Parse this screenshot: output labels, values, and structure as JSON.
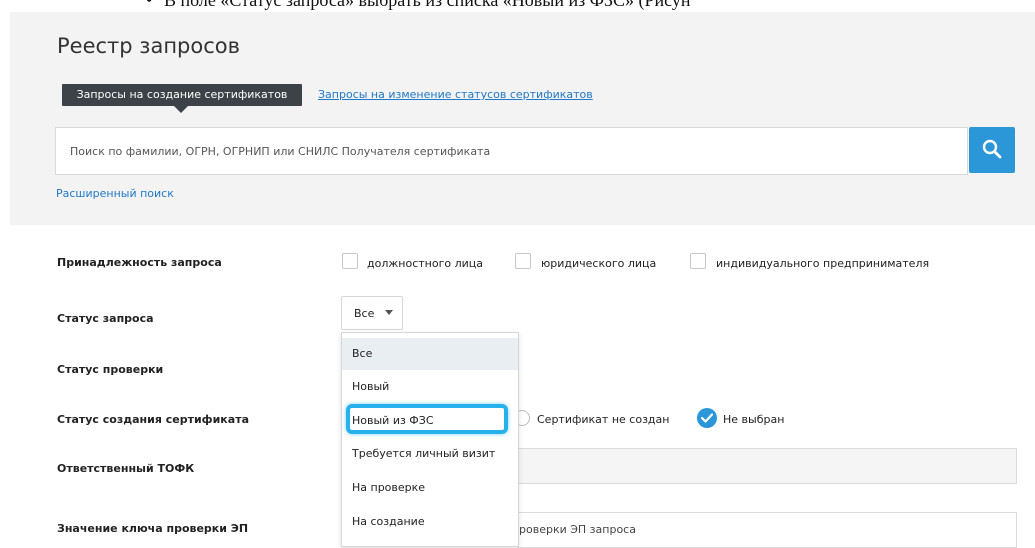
{
  "document": {
    "bullet": "•",
    "instruction_text": "В поле «Статус запроса» выбрать из списка «Новый из ФЗС» (Рисун"
  },
  "page": {
    "title": "Реестр запросов"
  },
  "tabs": {
    "active_label": "Запросы на создание сертификатов",
    "link_label": "Запросы на изменение статусов сертификатов"
  },
  "search": {
    "placeholder": "Поиск по фамилии, ОГРН, ОГРНИП или СНИЛС Получателя сертификата",
    "value": "",
    "button_icon": "search-icon",
    "advanced_link": "Расширенный поиск"
  },
  "form": {
    "affiliation": {
      "label": "Принадлежность запроса",
      "options": [
        "должностного лица",
        "юридического лица",
        "индивидуального предпринимателя"
      ]
    },
    "request_status": {
      "label": "Статус запроса",
      "selected": "Все"
    },
    "check_status": {
      "label": "Статус проверки"
    },
    "creation_status": {
      "label": "Статус создания сертификата",
      "options": [
        "Сертификат не создан",
        "Не выбран"
      ],
      "selected": "Не выбран"
    },
    "responsible_tofk": {
      "label": "Ответственный ТОФК"
    },
    "key_value": {
      "label": "Значение ключа проверки ЭП",
      "placeholder_visible": "роверки ЭП запроса"
    }
  },
  "dropdown": {
    "options": [
      "Все",
      "Новый",
      "Новый из ФЗС",
      "Требуется личный визит",
      "На проверке",
      "На создание"
    ],
    "hovered": "Все",
    "highlighted": "Новый из ФЗС"
  },
  "colors": {
    "accent": "#2b97d9",
    "link": "#1f78c8",
    "tab_active_bg": "#3c4247",
    "highlight_ring": "#27b1ec",
    "panel_bg": "#f3f3f3"
  }
}
